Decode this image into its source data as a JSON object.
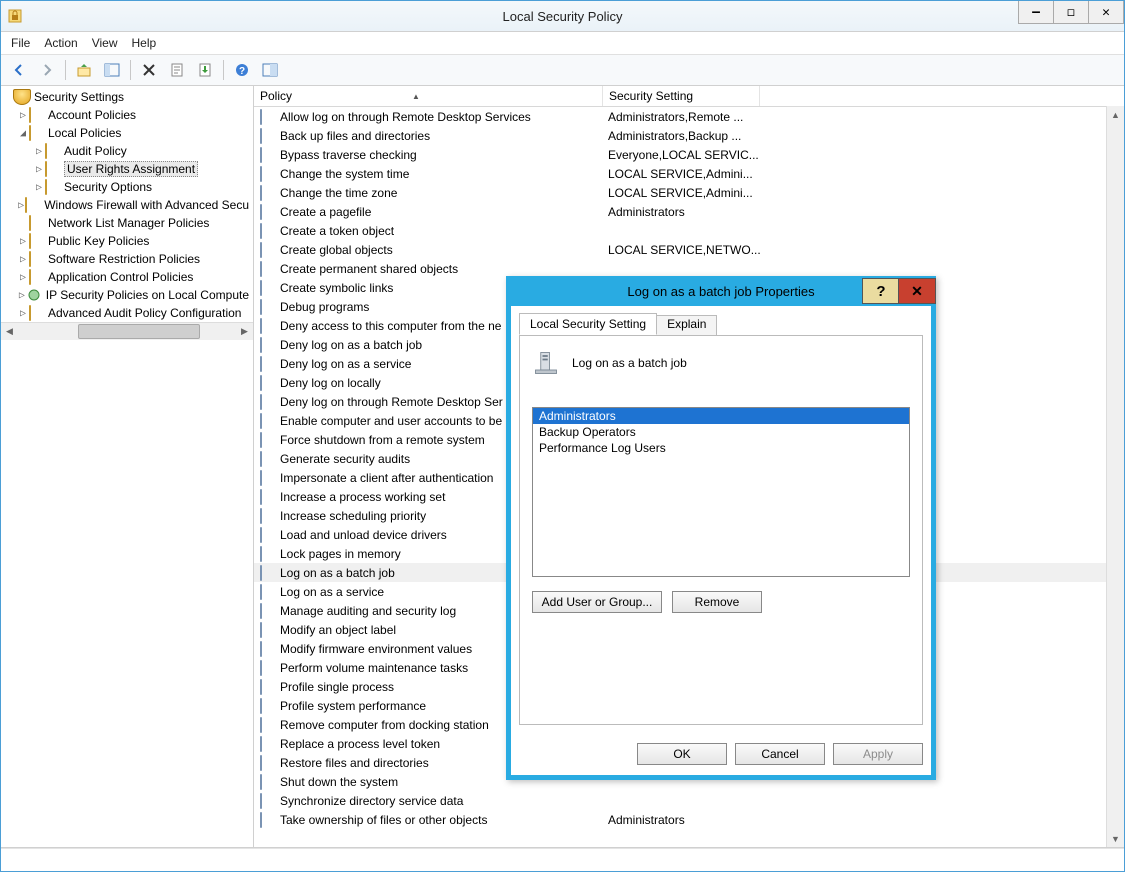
{
  "window": {
    "title": "Local Security Policy"
  },
  "menu": {
    "file": "File",
    "action": "Action",
    "view": "View",
    "help": "Help"
  },
  "tree": {
    "root": "Security Settings",
    "items": [
      {
        "tw": "▷",
        "ind": 1,
        "label": "Account Policies"
      },
      {
        "tw": "◢",
        "ind": 1,
        "label": "Local Policies"
      },
      {
        "tw": "▷",
        "ind": 2,
        "label": "Audit Policy"
      },
      {
        "tw": "▷",
        "ind": 2,
        "label": "User Rights Assignment",
        "sel": true
      },
      {
        "tw": "▷",
        "ind": 2,
        "label": "Security Options"
      },
      {
        "tw": "▷",
        "ind": 1,
        "label": "Windows Firewall with Advanced Secu"
      },
      {
        "tw": "",
        "ind": 1,
        "label": "Network List Manager Policies"
      },
      {
        "tw": "▷",
        "ind": 1,
        "label": "Public Key Policies"
      },
      {
        "tw": "▷",
        "ind": 1,
        "label": "Software Restriction Policies"
      },
      {
        "tw": "▷",
        "ind": 1,
        "label": "Application Control Policies"
      },
      {
        "tw": "▷",
        "ind": 1,
        "label": "IP Security Policies on Local Compute",
        "icon": "ip"
      },
      {
        "tw": "▷",
        "ind": 1,
        "label": "Advanced Audit Policy Configuration"
      }
    ]
  },
  "columns": {
    "policy": "Policy",
    "setting": "Security Setting"
  },
  "rows": [
    {
      "p": "Allow log on through Remote Desktop Services",
      "s": "Administrators,Remote ..."
    },
    {
      "p": "Back up files and directories",
      "s": "Administrators,Backup ..."
    },
    {
      "p": "Bypass traverse checking",
      "s": "Everyone,LOCAL SERVIC..."
    },
    {
      "p": "Change the system time",
      "s": "LOCAL SERVICE,Admini..."
    },
    {
      "p": "Change the time zone",
      "s": "LOCAL SERVICE,Admini..."
    },
    {
      "p": "Create a pagefile",
      "s": "Administrators"
    },
    {
      "p": "Create a token object",
      "s": ""
    },
    {
      "p": "Create global objects",
      "s": "LOCAL SERVICE,NETWO..."
    },
    {
      "p": "Create permanent shared objects",
      "s": ""
    },
    {
      "p": "Create symbolic links",
      "s": ""
    },
    {
      "p": "Debug programs",
      "s": ""
    },
    {
      "p": "Deny access to this computer from the ne",
      "s": ""
    },
    {
      "p": "Deny log on as a batch job",
      "s": ""
    },
    {
      "p": "Deny log on as a service",
      "s": ""
    },
    {
      "p": "Deny log on locally",
      "s": ""
    },
    {
      "p": "Deny log on through Remote Desktop Ser",
      "s": ""
    },
    {
      "p": "Enable computer and user accounts to be",
      "s": ""
    },
    {
      "p": "Force shutdown from a remote system",
      "s": ""
    },
    {
      "p": "Generate security audits",
      "s": ""
    },
    {
      "p": "Impersonate a client after authentication",
      "s": ""
    },
    {
      "p": "Increase a process working set",
      "s": ""
    },
    {
      "p": "Increase scheduling priority",
      "s": ""
    },
    {
      "p": "Load and unload device drivers",
      "s": ""
    },
    {
      "p": "Lock pages in memory",
      "s": ""
    },
    {
      "p": "Log on as a batch job",
      "s": "",
      "sel": true
    },
    {
      "p": "Log on as a service",
      "s": ""
    },
    {
      "p": "Manage auditing and security log",
      "s": ""
    },
    {
      "p": "Modify an object label",
      "s": ""
    },
    {
      "p": "Modify firmware environment values",
      "s": ""
    },
    {
      "p": "Perform volume maintenance tasks",
      "s": ""
    },
    {
      "p": "Profile single process",
      "s": ""
    },
    {
      "p": "Profile system performance",
      "s": ""
    },
    {
      "p": "Remove computer from docking station",
      "s": ""
    },
    {
      "p": "Replace a process level token",
      "s": ""
    },
    {
      "p": "Restore files and directories",
      "s": ""
    },
    {
      "p": "Shut down the system",
      "s": ""
    },
    {
      "p": "Synchronize directory service data",
      "s": ""
    },
    {
      "p": "Take ownership of files or other objects",
      "s": "Administrators"
    }
  ],
  "dialog": {
    "title": "Log on as a batch job Properties",
    "tabs": {
      "local": "Local Security Setting",
      "explain": "Explain"
    },
    "policy_name": "Log on as a batch job",
    "members": [
      {
        "n": "Administrators",
        "sel": true
      },
      {
        "n": "Backup Operators"
      },
      {
        "n": "Performance Log Users"
      }
    ],
    "add": "Add User or Group...",
    "remove": "Remove",
    "ok": "OK",
    "cancel": "Cancel",
    "apply": "Apply"
  }
}
